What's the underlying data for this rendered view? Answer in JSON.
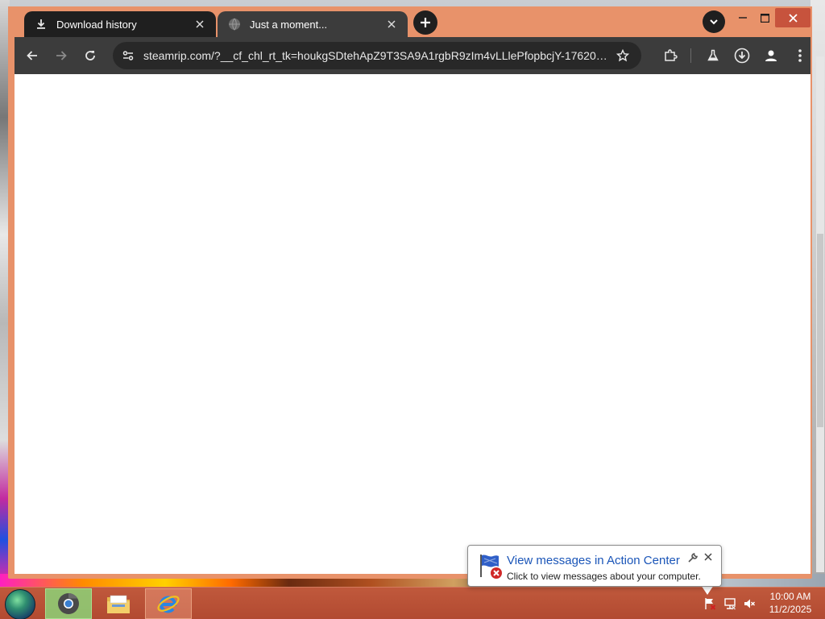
{
  "browser": {
    "tabs": [
      {
        "title": "Download history",
        "icon": "download-icon",
        "active": false
      },
      {
        "title": "Just a moment...",
        "icon": "globe-icon",
        "active": true
      }
    ],
    "address_bar": {
      "url": "steamrip.com/?__cf_chl_rt_tk=houkgSDtehApZ9T3SA9A1rgbR9zIm4vLLlePfopbcjY-17620992..."
    },
    "toolbar_icons": [
      "back-icon",
      "forward-icon",
      "reload-icon",
      "site-info-icon",
      "bookmark-star-icon",
      "extensions-icon",
      "labs-flask-icon",
      "downloads-icon",
      "profile-icon",
      "menu-icon"
    ]
  },
  "notification": {
    "title": "View messages in Action Center",
    "text": "Click to view messages about your computer."
  },
  "taskbar": {
    "clock_time": "10:00 AM",
    "clock_date": "11/2/2025",
    "pinned": [
      "chrome-icon",
      "file-explorer-icon",
      "internet-explorer-icon"
    ]
  },
  "colors": {
    "frame": "#e8926a",
    "toolbar": "#3c3c3c",
    "taskbar": "#b84f35",
    "balloon_title": "#1a55b8"
  }
}
